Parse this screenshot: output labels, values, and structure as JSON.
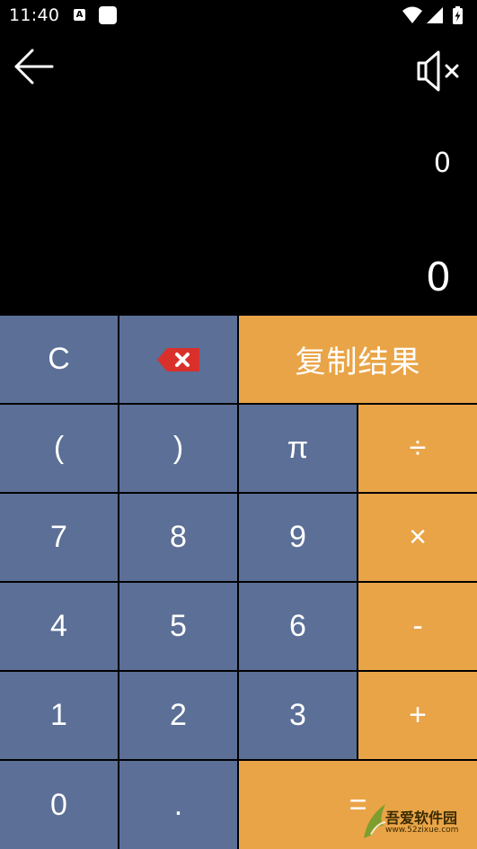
{
  "status_bar": {
    "time": "11:40",
    "notification_letter": "A"
  },
  "display": {
    "expression": "0",
    "result": "0"
  },
  "keys": {
    "clear": "C",
    "copy_result": "复制结果",
    "open_paren": "(",
    "close_paren": ")",
    "pi": "π",
    "divide": "÷",
    "seven": "7",
    "eight": "8",
    "nine": "9",
    "multiply": "×",
    "four": "4",
    "five": "5",
    "six": "6",
    "minus": "-",
    "one": "1",
    "two": "2",
    "three": "3",
    "plus": "+",
    "zero": "0",
    "dot": ".",
    "equals": "="
  },
  "icons": {
    "back": "arrow-left-icon",
    "sound": "speaker-muted-icon",
    "backspace": "backspace-icon"
  },
  "colors": {
    "number_key": "#5b6f97",
    "operator_key": "#e9a447",
    "background": "#000000",
    "backspace_icon": "#d9302c"
  },
  "watermark": {
    "name": "吾爱软件园",
    "url": "www.52zixue.com"
  }
}
